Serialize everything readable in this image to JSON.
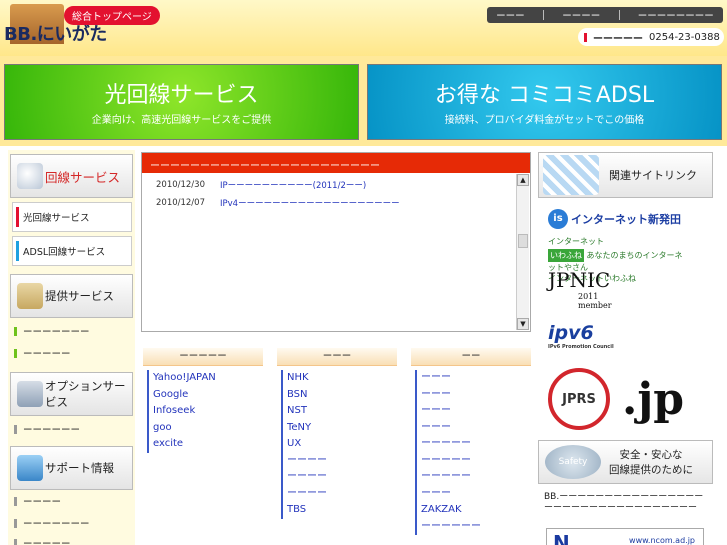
{
  "header": {
    "logo_text": "BB.にいがた",
    "badge": "総合トップページ",
    "nav": [
      "ーーー",
      "ーーーー",
      "ーーーーーーーー"
    ],
    "phone_label": "ーーーーー",
    "phone": "0254-23-0388"
  },
  "banners": {
    "hikari": {
      "title": "光回線サービス",
      "sub": "企業向け、高速光回線サービスをご提供"
    },
    "adsl": {
      "title": "お得な コミコミADSL",
      "sub": "接続料、プロバイダ料金がセットでこの価格"
    }
  },
  "sidebar": {
    "line_services": "回線サービス",
    "line_items": [
      "光回線サービス",
      "ADSL回線サービス"
    ],
    "provided": "提供サービス",
    "provided_items": [
      "ーーーーーーー",
      "ーーーーー"
    ],
    "options": "オプションサービス",
    "option_items": [
      "ーーーーーー"
    ],
    "support": "サポート情報",
    "support_items": [
      "ーーーー",
      "ーーーーーーー",
      "ーーーーー"
    ]
  },
  "news": {
    "heading": "ーーーーーーーーーーーーーーーーーーーーーーー",
    "rows": [
      {
        "date": "2010/12/30",
        "title": "IPーーーーーーーーーー(2011/2ーー)"
      },
      {
        "date": "2010/12/07",
        "title": "IPv4ーーーーーーーーーーーーーーーーーーー"
      }
    ]
  },
  "columns": [
    {
      "head": "ーーーーー",
      "links": [
        "Yahoo!JAPAN",
        "Google",
        "Infoseek",
        "goo",
        "excite"
      ]
    },
    {
      "head": "ーーー",
      "links": [
        "NHK",
        "BSN",
        "NST",
        "TeNY",
        "UX",
        "ーーーー",
        "ーーーー",
        "ーーーー",
        "TBS"
      ]
    },
    {
      "head": "ーー",
      "links": [
        "ーーー",
        "ーーー",
        "ーーー",
        "ーーー",
        "ーーーーー",
        "ーーーーー",
        "ーーーーー",
        "ーーー",
        "ZAKZAK",
        "ーーーーーー"
      ]
    }
  ],
  "right": {
    "related": "関連サイトリンク",
    "inet": "インターネット新発田",
    "iwafune_top": "インターネット",
    "iwafune_box": "いわふね",
    "iwafune_small": "あなたのまちのインターネットやさん",
    "iwafune_name": "インターネットいわふね",
    "jpnic": "JPNIC",
    "jpnic_year": "2011",
    "jpnic_member": "member",
    "ipv6": "ipv6",
    "ipv6_sub": "IPv6 Promotion Council",
    "jprs": "JPRS",
    "jprs_jp": ".jp",
    "safety_icon": "Safety",
    "safety_line1": "安全・安心な",
    "safety_line2": "回線提供のために",
    "bb_note": "BB.ーーーーーーーーーーーーーーーーーーーーーーーーーーーーーーーーー",
    "ncom_url": "www.ncom.ad.jp",
    "ncom_letter": "N"
  }
}
